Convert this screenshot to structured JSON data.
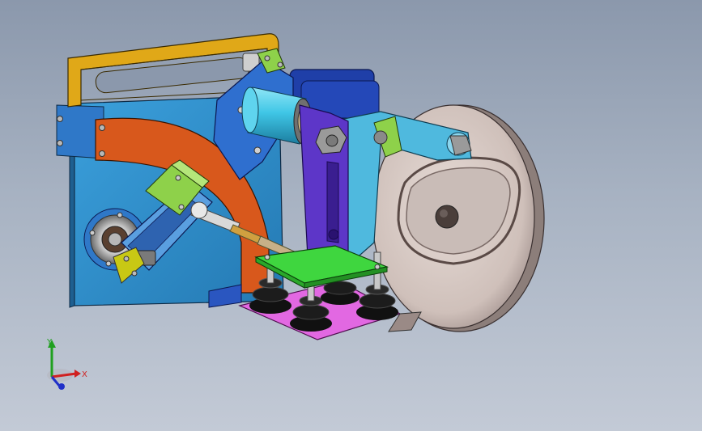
{
  "triad": {
    "x_label": "X",
    "y_label": "Y"
  },
  "colors": {
    "background_top": "#8b98ac",
    "background_bottom": "#c3cad6",
    "frame_plate": "#2e90cc",
    "handle": "#e0a818",
    "arc_plate": "#d8581c",
    "side_plate": "#2f6fcf",
    "cylinder": "#3fc6e6",
    "column": "#5d36c8",
    "arm": "#4fb9de",
    "lever": "#5a9fe0",
    "pink_base": "#e268e2",
    "green_plate": "#3fd63f",
    "wheel": "#d7c9c4",
    "rubber_feet": "#111111"
  }
}
